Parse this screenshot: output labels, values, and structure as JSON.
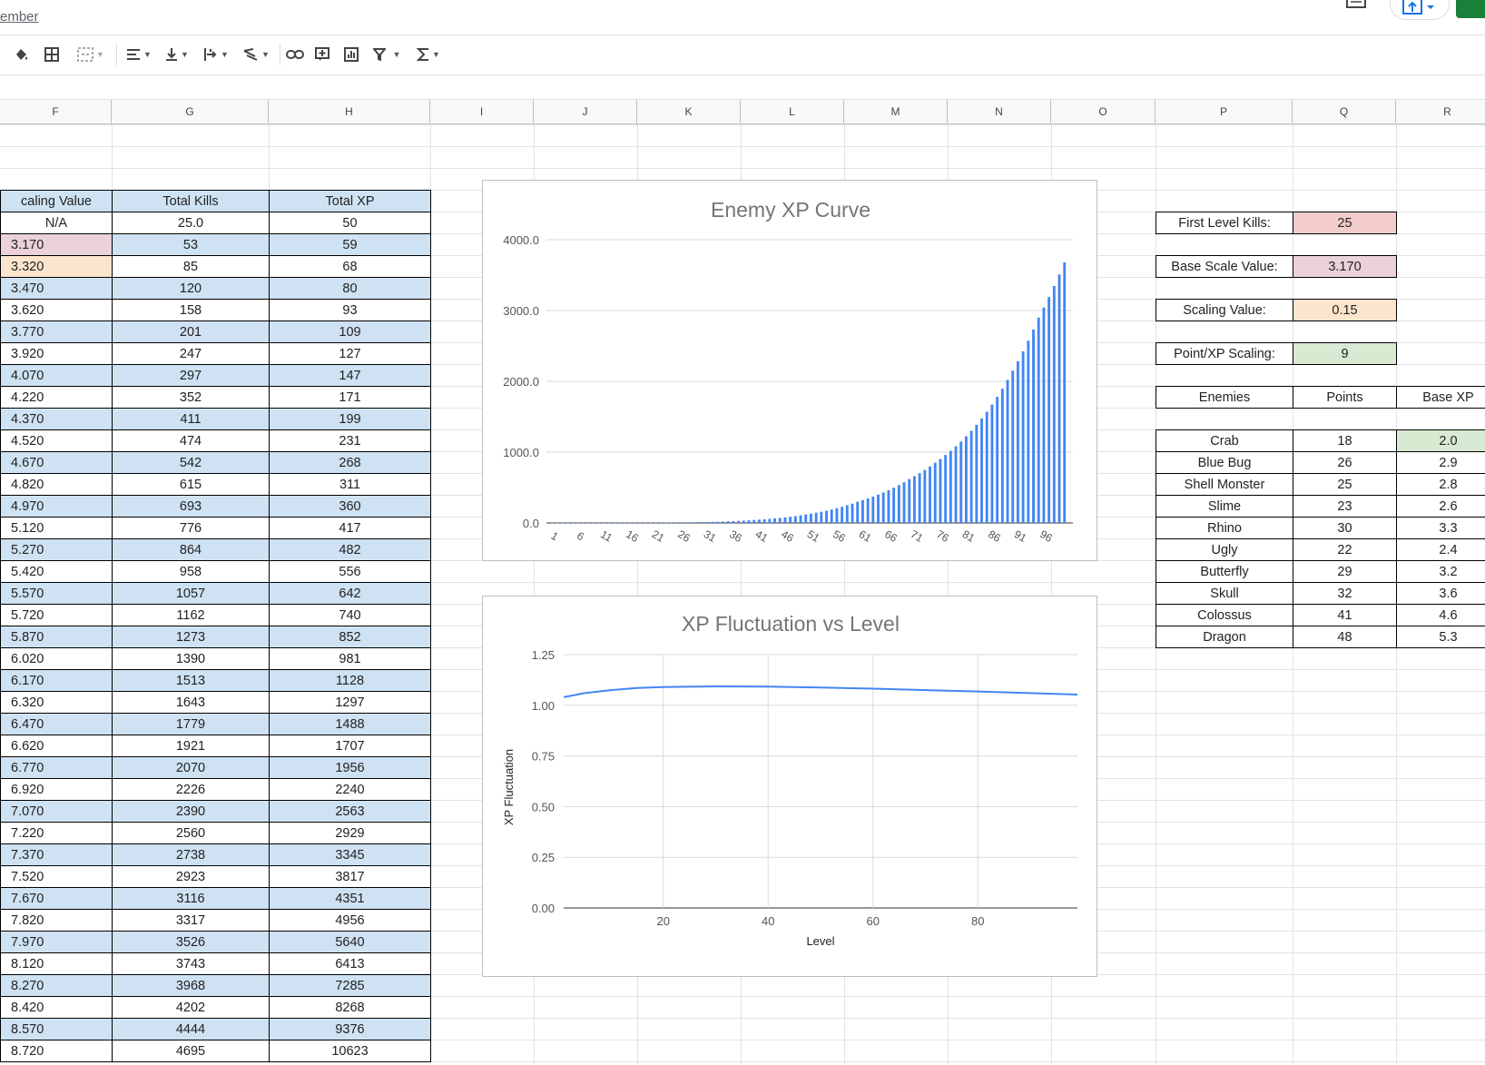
{
  "doc": {
    "title_fragment": "ember"
  },
  "toolbar": {
    "items": [
      "fill-color",
      "borders",
      "merge-cells",
      "horizontal-align",
      "vertical-align",
      "text-wrapping",
      "text-rotation",
      "insert-link",
      "insert-comment",
      "insert-chart",
      "create-filter",
      "functions"
    ]
  },
  "columns": [
    "F",
    "G",
    "H",
    "I",
    "J",
    "K",
    "L",
    "M",
    "N",
    "O",
    "P",
    "Q",
    "R"
  ],
  "main_table": {
    "headers": [
      "caling Value",
      "Total Kills",
      "Total XP"
    ],
    "rows": [
      [
        "N/A",
        "25.0",
        "50"
      ],
      [
        "3.170",
        "53",
        "59"
      ],
      [
        "3.320",
        "85",
        "68"
      ],
      [
        "3.470",
        "120",
        "80"
      ],
      [
        "3.620",
        "158",
        "93"
      ],
      [
        "3.770",
        "201",
        "109"
      ],
      [
        "3.920",
        "247",
        "127"
      ],
      [
        "4.070",
        "297",
        "147"
      ],
      [
        "4.220",
        "352",
        "171"
      ],
      [
        "4.370",
        "411",
        "199"
      ],
      [
        "4.520",
        "474",
        "231"
      ],
      [
        "4.670",
        "542",
        "268"
      ],
      [
        "4.820",
        "615",
        "311"
      ],
      [
        "4.970",
        "693",
        "360"
      ],
      [
        "5.120",
        "776",
        "417"
      ],
      [
        "5.270",
        "864",
        "482"
      ],
      [
        "5.420",
        "958",
        "556"
      ],
      [
        "5.570",
        "1057",
        "642"
      ],
      [
        "5.720",
        "1162",
        "740"
      ],
      [
        "5.870",
        "1273",
        "852"
      ],
      [
        "6.020",
        "1390",
        "981"
      ],
      [
        "6.170",
        "1513",
        "1128"
      ],
      [
        "6.320",
        "1643",
        "1297"
      ],
      [
        "6.470",
        "1779",
        "1488"
      ],
      [
        "6.620",
        "1921",
        "1707"
      ],
      [
        "6.770",
        "2070",
        "1956"
      ],
      [
        "6.920",
        "2226",
        "2240"
      ],
      [
        "7.070",
        "2390",
        "2563"
      ],
      [
        "7.220",
        "2560",
        "2929"
      ],
      [
        "7.370",
        "2738",
        "3345"
      ],
      [
        "7.520",
        "2923",
        "3817"
      ],
      [
        "7.670",
        "3116",
        "4351"
      ],
      [
        "7.820",
        "3317",
        "4956"
      ],
      [
        "7.970",
        "3526",
        "5640"
      ],
      [
        "8.120",
        "3743",
        "6413"
      ],
      [
        "8.270",
        "3968",
        "7285"
      ],
      [
        "8.420",
        "4202",
        "8268"
      ],
      [
        "8.570",
        "4444",
        "9376"
      ],
      [
        "8.720",
        "4695",
        "10623"
      ]
    ]
  },
  "params": [
    {
      "label": "First Level Kills:",
      "value": "25",
      "color": "#f4cccc"
    },
    {
      "label": "Base Scale Value:",
      "value": "3.170",
      "color": "#ead1dc"
    },
    {
      "label": "Scaling Value:",
      "value": "0.15",
      "color": "#fce5cd"
    },
    {
      "label": "Point/XP Scaling:",
      "value": "9",
      "color": "#d9ead3"
    }
  ],
  "enemies": {
    "headers": [
      "Enemies",
      "Points",
      "Base XP"
    ],
    "rows": [
      [
        "Crab",
        "18",
        "2.0"
      ],
      [
        "Blue Bug",
        "26",
        "2.9"
      ],
      [
        "Shell Monster",
        "25",
        "2.8"
      ],
      [
        "Slime",
        "23",
        "2.6"
      ],
      [
        "Rhino",
        "30",
        "3.3"
      ],
      [
        "Ugly",
        "22",
        "2.4"
      ],
      [
        "Butterfly",
        "29",
        "3.2"
      ],
      [
        "Skull",
        "32",
        "3.6"
      ],
      [
        "Colossus",
        "41",
        "4.6"
      ],
      [
        "Dragon",
        "48",
        "5.3"
      ]
    ]
  },
  "colors": {
    "row_blue": "#cfe2f3",
    "row_pink": "#ead1dc",
    "row_orange": "#fce5cd",
    "header_blue": "#cfe2f3",
    "series_blue": "#4285f4",
    "green_cell": "#d9ead3"
  },
  "chart_data": [
    {
      "type": "bar",
      "title": "Enemy XP Curve",
      "x_tick_labels": [
        "1",
        "6",
        "11",
        "16",
        "21",
        "26",
        "31",
        "36",
        "41",
        "46",
        "51",
        "56",
        "61",
        "66",
        "71",
        "76",
        "81",
        "86",
        "91",
        "96"
      ],
      "y_tick_labels": [
        "0.0",
        "1000.0",
        "2000.0",
        "3000.0",
        "4000.0"
      ],
      "ylim": [
        0,
        4000
      ],
      "x_range": [
        1,
        100
      ],
      "values_approx": {
        "levels": [
          1,
          20,
          30,
          40,
          50,
          60,
          65,
          70,
          75,
          80,
          85,
          90,
          95,
          100
        ],
        "values": [
          0,
          4,
          12,
          42,
          120,
          300,
          430,
          620,
          850,
          1150,
          1570,
          2150,
          2900,
          3680
        ]
      },
      "grid": true,
      "legend": "none"
    },
    {
      "type": "line",
      "title": "XP Fluctuation vs Level",
      "xlabel": "Level",
      "ylabel": "XP Fluctuation",
      "x_tick_labels": [
        "20",
        "40",
        "60",
        "80"
      ],
      "y_tick_labels": [
        "0.00",
        "0.25",
        "0.50",
        "0.75",
        "1.00",
        "1.25"
      ],
      "xlim": [
        1,
        99
      ],
      "ylim": [
        0,
        1.25
      ],
      "x": [
        1,
        5,
        10,
        15,
        20,
        30,
        40,
        50,
        60,
        70,
        80,
        90,
        99
      ],
      "y": [
        1.04,
        1.06,
        1.075,
        1.085,
        1.09,
        1.093,
        1.092,
        1.088,
        1.082,
        1.075,
        1.068,
        1.06,
        1.053
      ],
      "grid": true,
      "legend": "none"
    }
  ]
}
